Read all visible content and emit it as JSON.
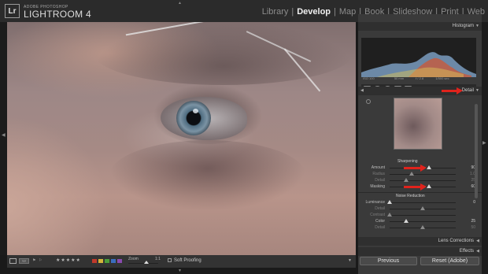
{
  "app": {
    "brand_small": "ADOBE PHOTOSHOP",
    "brand_name": "LIGHTROOM 4",
    "logo": "Lr"
  },
  "modules": [
    {
      "label": "Library",
      "active": false
    },
    {
      "label": "Develop",
      "active": true
    },
    {
      "label": "Map",
      "active": false
    },
    {
      "label": "Book",
      "active": false
    },
    {
      "label": "Slideshow",
      "active": false
    },
    {
      "label": "Print",
      "active": false
    },
    {
      "label": "Web",
      "active": false
    }
  ],
  "panels": {
    "histogram": {
      "title": "Histogram",
      "info": [
        "ISO 100",
        "50 mm",
        "f / 2.8",
        "1/500 sec"
      ]
    },
    "detail": {
      "title": "Detail"
    },
    "lens_corrections": {
      "title": "Lens Corrections"
    },
    "effects": {
      "title": "Effects"
    }
  },
  "sharpening": {
    "title": "Sharpening",
    "rows": [
      {
        "label": "Amount",
        "value": "90",
        "fraction": 0.6,
        "dim": false
      },
      {
        "label": "Radius",
        "value": "1.0",
        "fraction": 0.33,
        "dim": true
      },
      {
        "label": "Detail",
        "value": "25",
        "fraction": 0.25,
        "dim": true
      },
      {
        "label": "Masking",
        "value": "60",
        "fraction": 0.6,
        "dim": false
      }
    ]
  },
  "noise_reduction": {
    "title": "Noise Reduction",
    "rows": [
      {
        "label": "Luminance",
        "value": "0",
        "fraction": 0.0,
        "dim": false
      },
      {
        "label": "Detail",
        "value": "",
        "fraction": 0.5,
        "dim": true
      },
      {
        "label": "Contrast",
        "value": "",
        "fraction": 0.0,
        "dim": true
      },
      {
        "label": "Color",
        "value": "25",
        "fraction": 0.25,
        "dim": false
      },
      {
        "label": "Detail",
        "value": "50",
        "fraction": 0.5,
        "dim": true
      }
    ]
  },
  "buttons": {
    "previous": "Previous",
    "reset": "Reset (Adobe)"
  },
  "toolbar": {
    "zoom_label": "Zoom",
    "zoom_value": "1:1",
    "soft_proofing": "Soft Proofing",
    "stars": "★★★★★",
    "color_labels": [
      "#c0392b",
      "#d4b43a",
      "#4a9b3a",
      "#3a6ebf",
      "#8a4ab0"
    ]
  },
  "colors": {
    "accent_arrow": "#e0231c"
  }
}
